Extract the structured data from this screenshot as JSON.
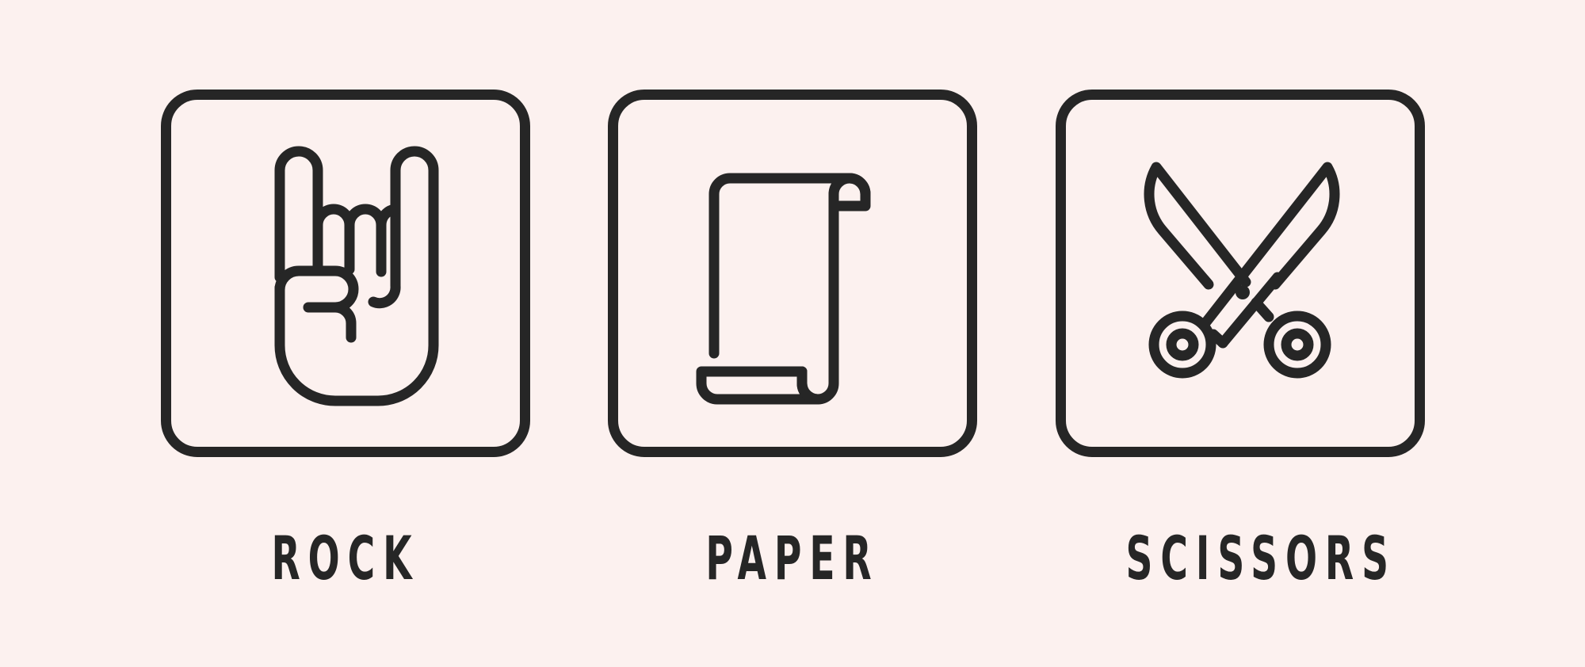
{
  "background_color": "#fcf1ef",
  "ink_color": "#262626",
  "choices": [
    {
      "label": "ROCK",
      "icon": "rock-hand-icon"
    },
    {
      "label": "PAPER",
      "icon": "paper-scroll-icon"
    },
    {
      "label": "SCISSORS",
      "icon": "scissors-icon"
    }
  ]
}
